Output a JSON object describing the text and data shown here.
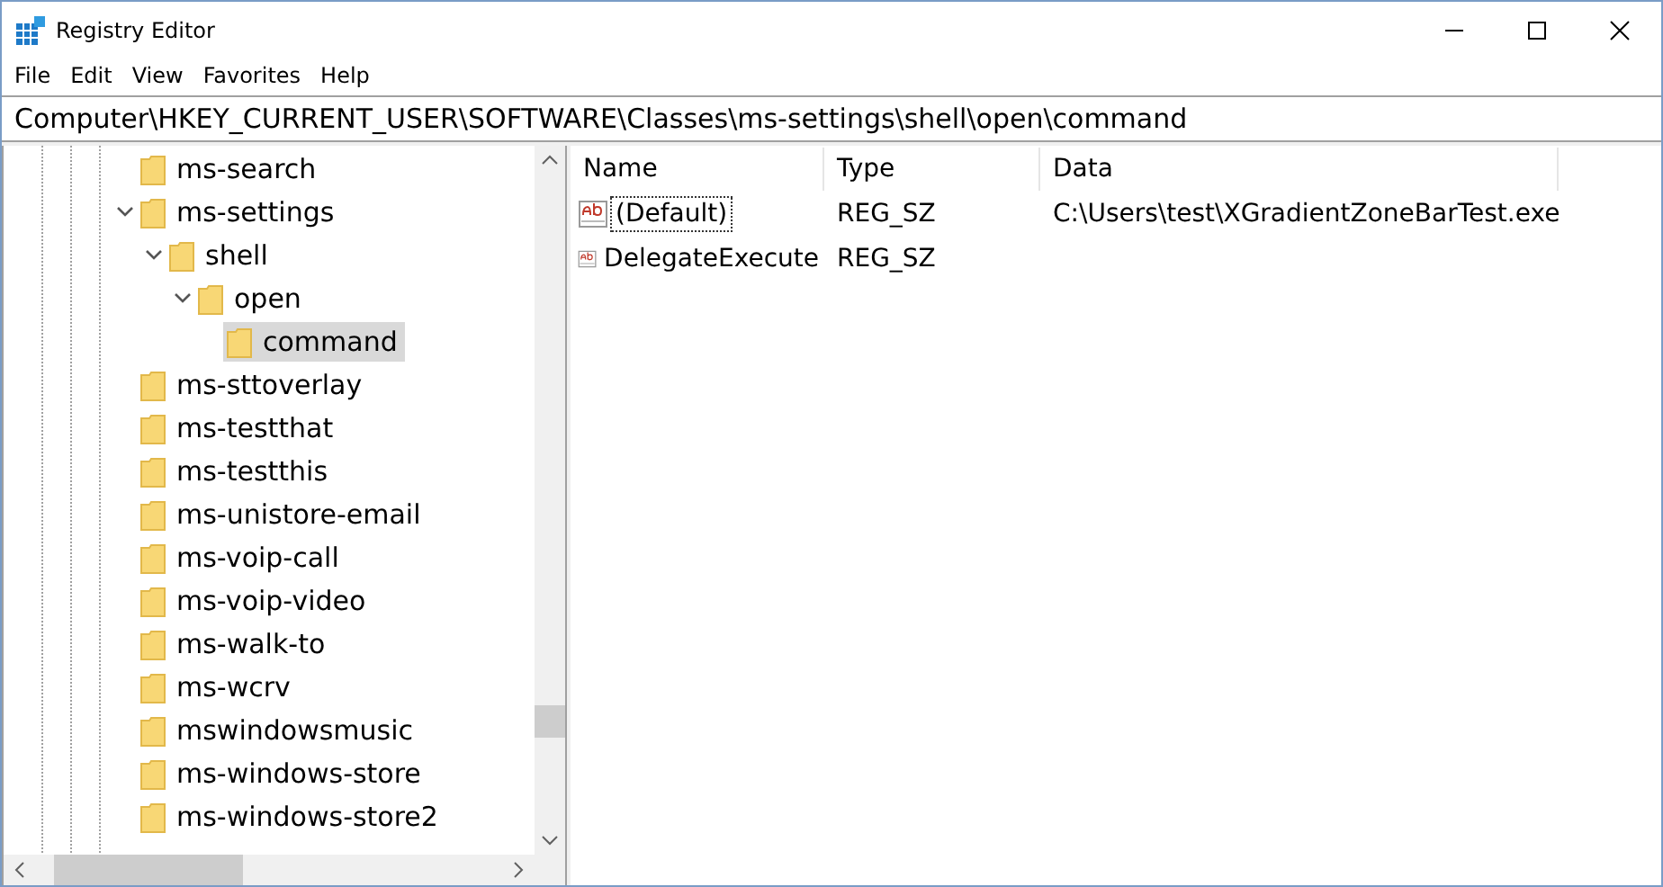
{
  "window": {
    "title": "Registry Editor"
  },
  "menu": [
    "File",
    "Edit",
    "View",
    "Favorites",
    "Help"
  ],
  "address": "Computer\\HKEY_CURRENT_USER\\SOFTWARE\\Classes\\ms-settings\\shell\\open\\command",
  "tree": [
    {
      "label": "ms-search",
      "selected": false
    },
    {
      "label": "ms-settings",
      "selected": false,
      "expanded": true,
      "children": [
        {
          "label": "shell",
          "selected": false,
          "expanded": true,
          "children": [
            {
              "label": "open",
              "selected": false,
              "expanded": true,
              "children": [
                {
                  "label": "command",
                  "selected": true
                }
              ]
            }
          ]
        }
      ]
    },
    {
      "label": "ms-sttoverlay",
      "selected": false
    },
    {
      "label": "ms-testthat",
      "selected": false
    },
    {
      "label": "ms-testthis",
      "selected": false
    },
    {
      "label": "ms-unistore-email",
      "selected": false
    },
    {
      "label": "ms-voip-call",
      "selected": false
    },
    {
      "label": "ms-voip-video",
      "selected": false
    },
    {
      "label": "ms-walk-to",
      "selected": false
    },
    {
      "label": "ms-wcrv",
      "selected": false
    },
    {
      "label": "mswindowsmusic",
      "selected": false
    },
    {
      "label": "ms-windows-store",
      "selected": false
    },
    {
      "label": "ms-windows-store2",
      "selected": false
    }
  ],
  "values": {
    "columns": [
      "Name",
      "Type",
      "Data"
    ],
    "rows": [
      {
        "name": "(Default)",
        "type": "REG_SZ",
        "data": "C:\\Users\\test\\XGradientZoneBarTest.exe",
        "focused": true
      },
      {
        "name": "DelegateExecute",
        "type": "REG_SZ",
        "focused": false
      }
    ]
  }
}
